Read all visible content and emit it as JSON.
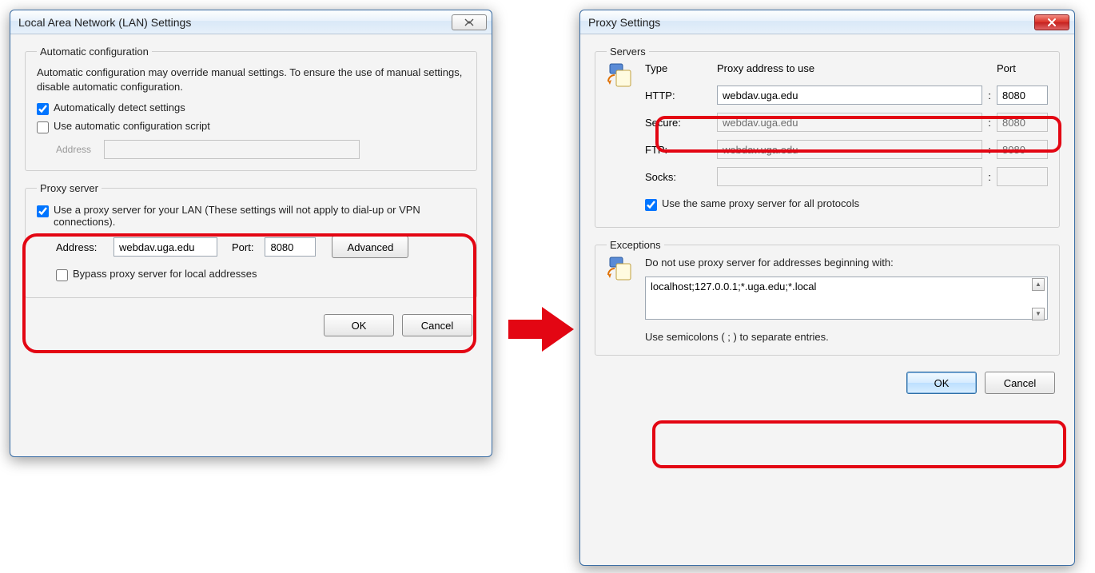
{
  "lan_dialog": {
    "title": "Local Area Network (LAN) Settings",
    "auto_legend": "Automatic configuration",
    "auto_desc": "Automatic configuration may override manual settings.  To ensure the use of manual settings, disable automatic configuration.",
    "auto_detect_label": "Automatically detect settings",
    "auto_script_label": "Use automatic configuration script",
    "auto_address_label": "Address",
    "proxy_legend": "Proxy server",
    "proxy_use_label": "Use a proxy server for your LAN (These settings will not apply to dial-up or VPN connections).",
    "proxy_address_label": "Address:",
    "proxy_address_value": "webdav.uga.edu",
    "proxy_port_label": "Port:",
    "proxy_port_value": "8080",
    "advanced_label": "Advanced",
    "bypass_label": "Bypass proxy server for local addresses",
    "ok_label": "OK",
    "cancel_label": "Cancel"
  },
  "proxy_dialog": {
    "title": "Proxy Settings",
    "servers_legend": "Servers",
    "col_type": "Type",
    "col_addr": "Proxy address to use",
    "col_port": "Port",
    "rows": [
      {
        "type": "HTTP:",
        "addr": "webdav.uga.edu",
        "port": "8080",
        "enabled": true
      },
      {
        "type": "Secure:",
        "addr": "webdav.uga.edu",
        "port": "8080",
        "enabled": false
      },
      {
        "type": "FTP:",
        "addr": "webdav.uga.edu",
        "port": "8080",
        "enabled": false
      },
      {
        "type": "Socks:",
        "addr": "",
        "port": "",
        "enabled": false
      }
    ],
    "same_proxy_label": "Use the same proxy server for all protocols",
    "exceptions_legend": "Exceptions",
    "exceptions_desc": "Do not use proxy server for addresses beginning with:",
    "exceptions_value": "localhost;127.0.0.1;*.uga.edu;*.local",
    "exceptions_hint": "Use semicolons ( ; ) to separate entries.",
    "ok_label": "OK",
    "cancel_label": "Cancel"
  }
}
